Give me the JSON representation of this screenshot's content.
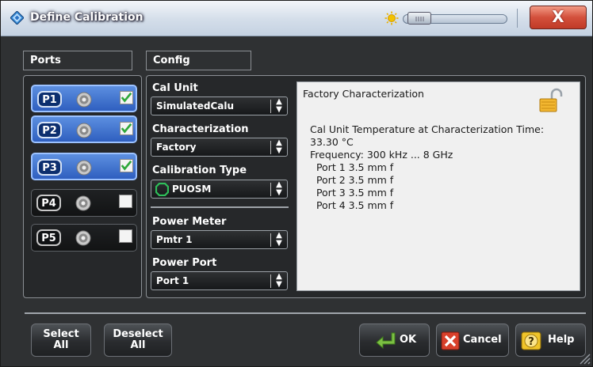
{
  "window": {
    "title": "Define Calibration",
    "close_label": "X"
  },
  "ports": {
    "header": "Ports",
    "items": [
      {
        "label": "P1",
        "checked": true
      },
      {
        "label": "P2",
        "checked": true
      },
      {
        "label": "P3",
        "checked": true
      },
      {
        "label": "P4",
        "checked": false
      },
      {
        "label": "P5",
        "checked": false
      }
    ]
  },
  "config": {
    "header": "Config",
    "cal_unit": {
      "label": "Cal Unit",
      "value": "SimulatedCalu"
    },
    "characterization": {
      "label": "Characterization",
      "value": "Factory"
    },
    "calibration_type": {
      "label": "Calibration Type",
      "value": "PUOSM"
    },
    "power_meter": {
      "label": "Power Meter",
      "value": "Pmtr 1"
    },
    "power_port": {
      "label": "Power Port",
      "value": "Port 1"
    }
  },
  "info": {
    "title": "Factory Characterization",
    "lines": [
      "Cal Unit Temperature at Characterization Time:",
      "33.30 °C",
      "Frequency: 300 kHz ... 8 GHz",
      "  Port 1 3.5 mm f",
      "  Port 2 3.5 mm f",
      "  Port 3 3.5 mm f",
      "  Port 4 3.5 mm f"
    ]
  },
  "buttons": {
    "select_all": [
      "Select",
      "All"
    ],
    "deselect_all": [
      "Deselect",
      "All"
    ],
    "ok": "OK",
    "cancel": "Cancel",
    "help": "Help"
  },
  "colors": {
    "selected_port": "#3d6fcf",
    "check": "#2ea83a",
    "info_bg": "#f0f0f0",
    "close": "#d3503c"
  },
  "icons": [
    "rs-logo-icon",
    "brightness-icon",
    "close-icon",
    "connector-icon",
    "checkbox-icon",
    "calkit-icon",
    "lock-icon",
    "ok-arrow-icon",
    "cancel-x-icon",
    "help-icon",
    "resize-grip-icon"
  ]
}
